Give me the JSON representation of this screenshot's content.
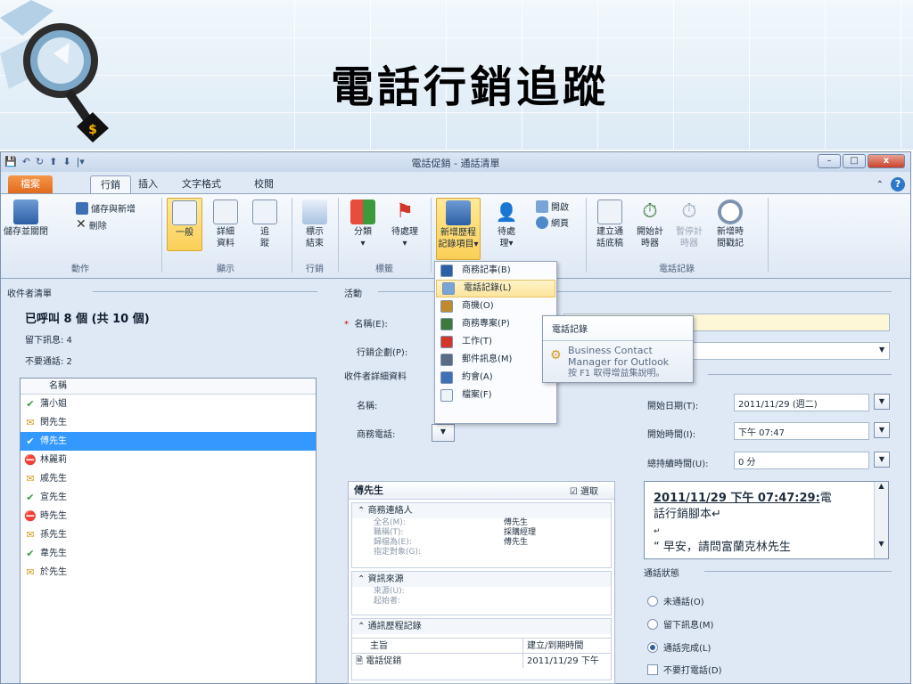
{
  "slide": {
    "title": "電話行銷追蹤"
  },
  "window": {
    "title": "電話促銷 - 通話清單",
    "controls": {
      "minimize": "–",
      "maximize": "□",
      "close": "x"
    }
  },
  "quick_access": [
    "💾",
    "↶",
    "↻",
    "⬆",
    "⬇",
    "|▾"
  ],
  "tabs": [
    {
      "label": "檔案"
    },
    {
      "label": "行銷"
    },
    {
      "label": "插入"
    },
    {
      "label": "文字格式"
    },
    {
      "label": "校閱"
    }
  ],
  "ribbon": {
    "groups": {
      "actions": {
        "label": "動作",
        "save_close": "儲存並關閉",
        "save_new": "儲存與新增",
        "delete": "刪除"
      },
      "display": {
        "label": "顯示",
        "general": "一般",
        "details_1": "詳細",
        "details_2": "資料",
        "trace_1": "追",
        "trace_2": "蹤"
      },
      "activity": {
        "label": "行銷",
        "mark_1": "標示",
        "mark_2": "結束"
      },
      "tags": {
        "label": "標籤",
        "category": "分類",
        "followup": "待處理"
      },
      "history": {
        "new_1": "新增歷程",
        "new_2": "記錄項目",
        "process_1": "待處",
        "process_2": "理",
        "open": "開啟",
        "web": "網頁"
      },
      "call_log": {
        "label": "電話記錄",
        "create_1": "建立通",
        "create_2": "話底稿",
        "start_1": "開始計",
        "start_2": "時器",
        "pause_1": "暫停計",
        "pause_2": "時器",
        "add_1": "新增時",
        "add_2": "間戳記"
      }
    }
  },
  "left": {
    "header": "收件者清單",
    "called_summary": "已呼叫 8 個 (共 10 個)",
    "left_message": "留下訊息: 4",
    "no_call": "不要通話: 2",
    "list_header": "名稱",
    "items": [
      {
        "name": "蒲小姐",
        "status": "done"
      },
      {
        "name": "閔先生",
        "status": "msg"
      },
      {
        "name": "傅先生",
        "status": "done",
        "selected": true
      },
      {
        "name": "林麗莉",
        "status": "no"
      },
      {
        "name": "戚先生",
        "status": "msg"
      },
      {
        "name": "宣先生",
        "status": "done"
      },
      {
        "name": "時先生",
        "status": "no"
      },
      {
        "name": "孫先生",
        "status": "msg"
      },
      {
        "name": "韋先生",
        "status": "done"
      },
      {
        "name": "於先生",
        "status": "msg"
      }
    ]
  },
  "activity": {
    "header": "活動",
    "name_label": "名稱(E):",
    "campaign_label": "行銷企劃(P):",
    "recipient_header": "收件者詳細資料",
    "recipient_name_label": "名稱:",
    "business_phone_label": "商務電話:"
  },
  "dropdown_menu": [
    {
      "label": "商務記事(B)"
    },
    {
      "label": "電話記錄(L)",
      "hover": true
    },
    {
      "label": "商機(O)"
    },
    {
      "label": "商務專案(P)"
    },
    {
      "label": "工作(T)"
    },
    {
      "label": "郵件訊息(M)"
    },
    {
      "label": "約會(A)"
    },
    {
      "label": "檔案(F)"
    }
  ],
  "tooltip": {
    "title": "電話記錄",
    "line1": "Business Contact",
    "line2": "Manager for Outlook",
    "line3": "按 F1 取得增益集說明。"
  },
  "schedule": {
    "start_date_label": "開始日期(T):",
    "start_date": "2011/11/29 (週二)",
    "start_time_label": "開始時間(I):",
    "start_time": "下午 07:47",
    "duration_label": "總持續時間(U):",
    "duration": "0 分"
  },
  "card": {
    "title": "傅先生",
    "select_btn": "選取",
    "business_contact": "商務連絡人",
    "full_name_label": "全名(M):",
    "full_name": "傅先生",
    "job_label": "職稱(T):",
    "job": "採購經理",
    "display_as_label": "歸檔為(E):",
    "display_as": "傅先生",
    "assigned_label": "指定對象(G):",
    "source_header": "資訊來源",
    "source_label": "來源(U):",
    "initiator_label": "起始者:",
    "history_header": "通訊歷程記錄",
    "col_subject": "主旨",
    "col_date": "建立/到期時間",
    "hist_subject": "電話促銷",
    "hist_date": "2011/11/29 下午"
  },
  "notes": {
    "timestamp": "2011/11/29  下午  07:47:29:",
    "line1_rest": "電",
    "line2": "話行銷腳本",
    "line3": "“  早安，請問富蘭克林先生"
  },
  "call_status": {
    "header": "通話狀態",
    "options": [
      {
        "label": "未通話(O)",
        "checked": false
      },
      {
        "label": "留下訊息(M)",
        "checked": false
      },
      {
        "label": "通話完成(L)",
        "checked": true
      }
    ],
    "no_call_label": "不要打電話(D)"
  }
}
